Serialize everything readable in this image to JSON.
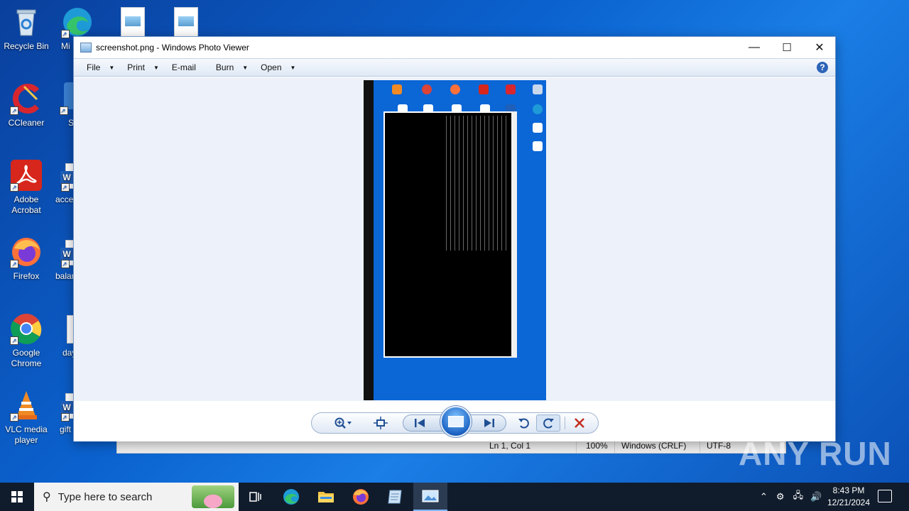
{
  "desktop": {
    "icons": [
      {
        "label": "Recycle Bin",
        "icon": "recycle-bin-icon"
      },
      {
        "label": "Mi",
        "icon": "edge-icon"
      },
      {
        "label": "CCleaner",
        "icon": "ccleaner-icon"
      },
      {
        "label": "Sl",
        "icon": "shortcut-icon"
      },
      {
        "label": "Adobe Acrobat",
        "icon": "adobe-acrobat-icon"
      },
      {
        "label": "acce",
        "icon": "word-document-icon"
      },
      {
        "label": "Firefox",
        "icon": "firefox-icon"
      },
      {
        "label": "balar",
        "icon": "word-document-icon"
      },
      {
        "label": "Google Chrome",
        "icon": "chrome-icon"
      },
      {
        "label": "day",
        "icon": "file-icon"
      },
      {
        "label": "VLC media player",
        "icon": "vlc-icon"
      },
      {
        "label": "gift",
        "icon": "word-document-icon"
      }
    ]
  },
  "notepad_status": {
    "position": "Ln 1, Col 1",
    "zoom": "100%",
    "line_ending": "Windows (CRLF)",
    "encoding": "UTF-8"
  },
  "photo_viewer": {
    "title": "screenshot.png - Windows Photo Viewer",
    "menu": [
      {
        "label": "File",
        "has_dropdown": true
      },
      {
        "label": "Print",
        "has_dropdown": true
      },
      {
        "label": "E-mail",
        "has_dropdown": false
      },
      {
        "label": "Burn",
        "has_dropdown": true
      },
      {
        "label": "Open",
        "has_dropdown": true
      }
    ],
    "window_controls": {
      "minimize": "—",
      "maximize": "☐",
      "close": "✕"
    },
    "help": "?",
    "controls": {
      "zoom": "zoom-icon",
      "actual_size": "actual-size-icon",
      "previous": "previous-icon",
      "slideshow": "slideshow-icon",
      "next": "next-icon",
      "rotate_ccw": "rotate-counterclockwise-icon",
      "rotate_cw": "rotate-clockwise-icon",
      "delete": "delete-icon"
    }
  },
  "taskbar": {
    "search_placeholder": "Type here to search",
    "time": "8:43 PM",
    "date": "12/21/2024",
    "apps": [
      "task-view-icon",
      "edge-icon",
      "file-explorer-icon",
      "firefox-icon",
      "notepad-icon",
      "photo-viewer-icon"
    ]
  },
  "watermark": "ANY RUN",
  "colors": {
    "desktop_bg": "#0b63d0",
    "taskbar_bg": "#101c2c",
    "delete_red": "#c42b1c",
    "accent": "#1f4f94"
  }
}
